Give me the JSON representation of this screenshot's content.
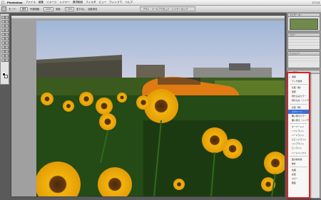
{
  "menubar": {
    "apple_icon": "apple-icon",
    "items": [
      "Photoshop",
      "ファイル",
      "編集",
      "イメージ",
      "レイヤー",
      "選択範囲",
      "フィルタ",
      "ビュー",
      "ウィンドウ",
      "ヘルプ"
    ],
    "clock": "17:13"
  },
  "optionsbar": {
    "items": [
      "モード：",
      "通常",
      "不透明度：",
      "100%",
      "流量：",
      "100%",
      "塗りなし",
      "自動消去"
    ],
    "palette_well": [
      "ブラシ",
      "ツールプリセット",
      "レイヤーカンプ"
    ]
  },
  "document": {
    "title": ""
  },
  "panels": [
    {
      "tab": "ナビゲーター"
    },
    {
      "tab": "カラー"
    },
    {
      "tab": "ヒストリー"
    },
    {
      "tab": "レイヤー"
    }
  ],
  "popup_menu": {
    "sections": [
      [
        "通常",
        "ディザ合成"
      ],
      [
        "比較（暗）",
        "乗算",
        "焼き込みカラー",
        "焼き込み（リニア）"
      ],
      [
        "比較（明）",
        "スクリーン",
        "覆い焼きカラー",
        "覆い焼き（リニア）"
      ],
      [
        "オーバーレイ",
        "ソフトライト",
        "ハードライト",
        "ビビッドライト",
        "リニアライト",
        "ピンライト",
        "ハードミックス"
      ],
      [
        "差の絶対値",
        "除外"
      ],
      [
        "色相",
        "彩度",
        "カラー",
        "輝度"
      ]
    ],
    "checked": "通常",
    "selected": "スクリーン"
  },
  "colors": {
    "highlight": "#3a6fd8",
    "frame": "#dd2222"
  }
}
